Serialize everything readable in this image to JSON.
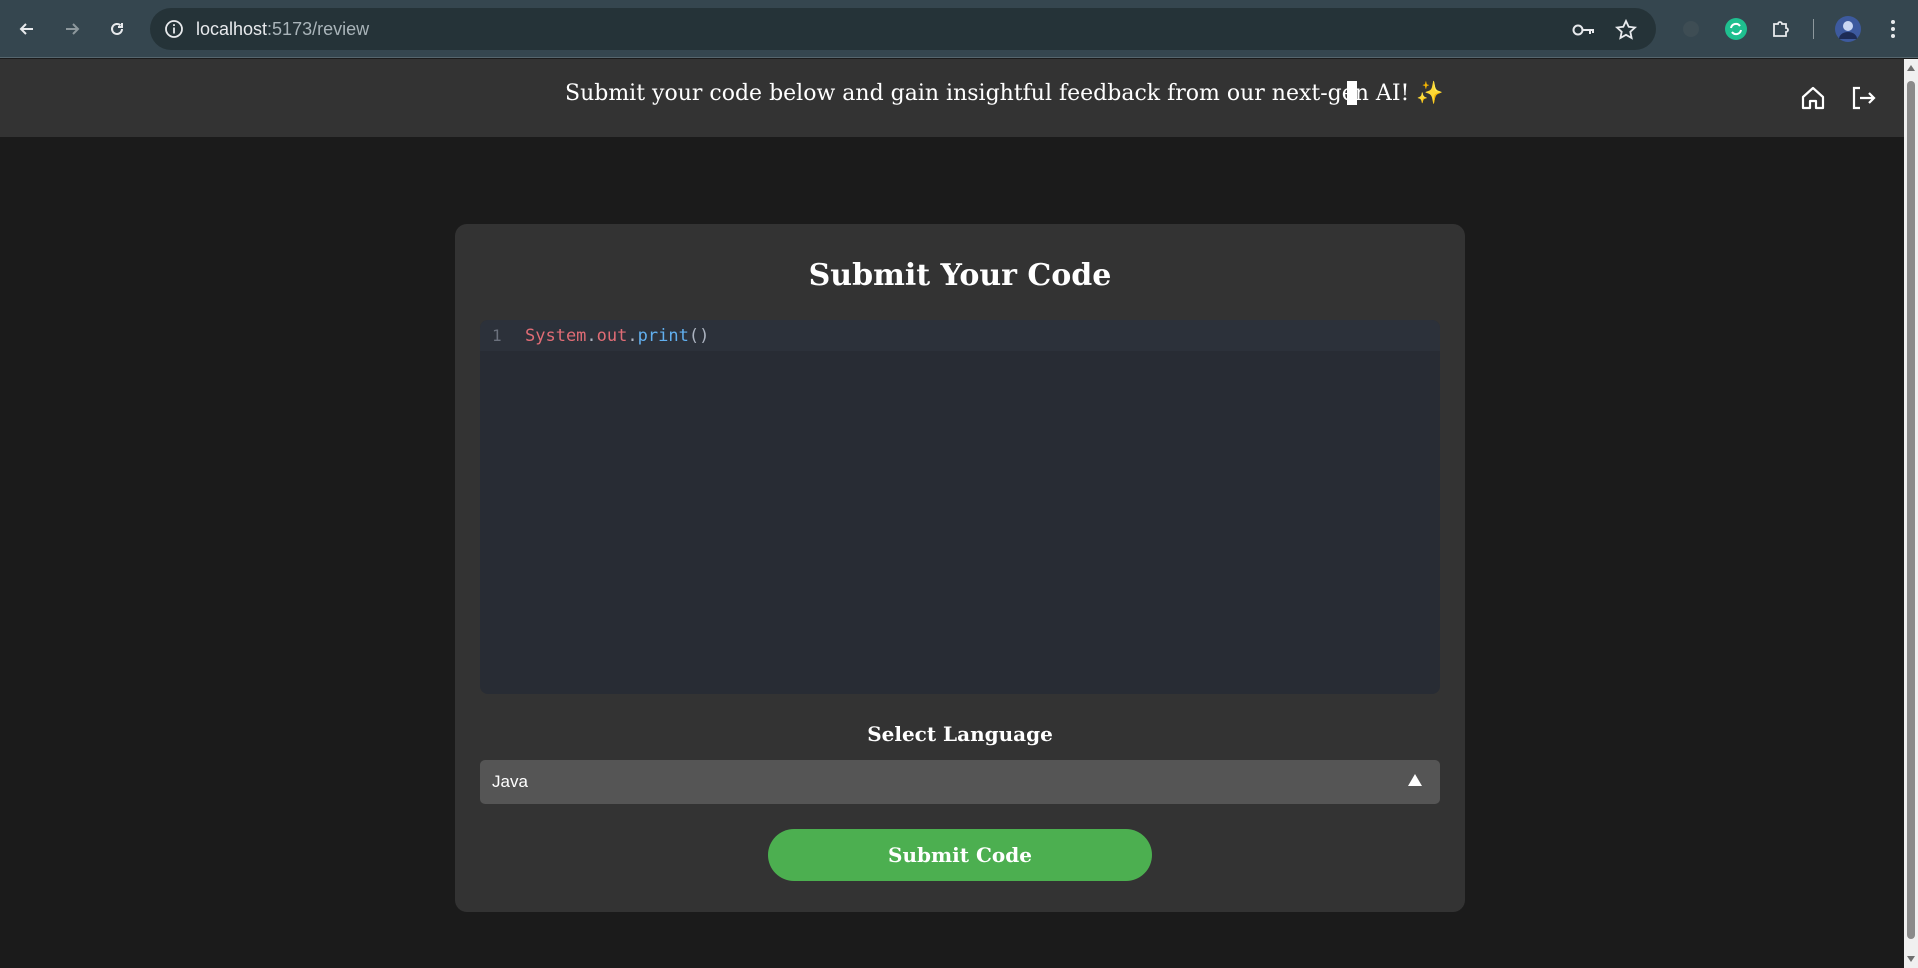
{
  "browser": {
    "url_host": "localhost",
    "url_path": ":5173/review"
  },
  "header": {
    "tagline": "Submit your code below and gain insightful feedback from our next-gen AI! ✨",
    "icons": [
      "home-icon",
      "logout-icon"
    ]
  },
  "card": {
    "title": "Submit Your Code",
    "editor": {
      "line_number": "1",
      "code_tokens": [
        "System",
        ".",
        "out",
        ".",
        "print",
        "()"
      ],
      "syntax_colors": {
        "identifier": "#e06c75",
        "punctuation": "#abb2bf",
        "method": "#61afef"
      }
    },
    "select_label": "Select Language",
    "select_value": "Java",
    "submit_label": "Submit Code"
  },
  "colors": {
    "accent": "#4caf50",
    "card_bg": "#333333",
    "page_bg": "#1b1b1b",
    "editor_bg": "#282c34"
  }
}
